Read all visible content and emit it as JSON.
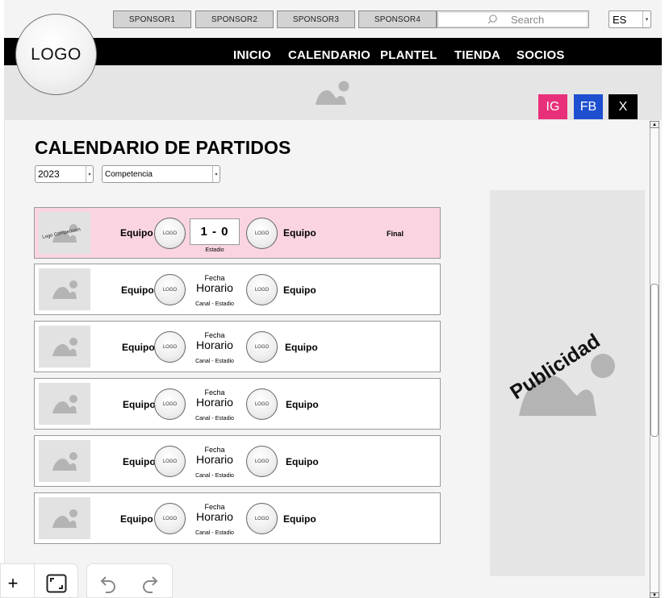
{
  "header": {
    "sponsors": [
      "SPONSOR1",
      "SPONSOR2",
      "SPONSOR3",
      "SPONSOR4"
    ],
    "search": {
      "placeholder": "Search"
    },
    "language": "ES",
    "logo": "LOGO"
  },
  "nav": {
    "items": [
      "INICIO",
      "CALENDARIO",
      "PLANTEL",
      "TIENDA",
      "SOCIOS"
    ]
  },
  "social": {
    "ig": "IG",
    "fb": "FB",
    "x": "X",
    "colors": {
      "ig": "#e8307a",
      "fb": "#1d4fd0",
      "x": "#000000"
    }
  },
  "page": {
    "title": "CALENDARIO DE PARTIDOS",
    "filters": {
      "year": "2023",
      "competition": "Competencia"
    }
  },
  "matches": [
    {
      "home": "Equipo",
      "away": "Equipo",
      "home_logo": "LOGO",
      "away_logo": "LOGO",
      "score": "1 - 0",
      "venue": "Estadio",
      "status": "Final",
      "thumb_label": "Logo Competicion"
    },
    {
      "home": "Equipo",
      "away": "Equipo",
      "home_logo": "LOGO",
      "away_logo": "LOGO",
      "date": "Fecha",
      "time": "Horario",
      "venue": "Canal - Estadio"
    },
    {
      "home": "Equipo",
      "away": "Equipo",
      "home_logo": "LOGO",
      "away_logo": "LOGO",
      "date": "Fecha",
      "time": "Horario",
      "venue": "Canal - Estadio"
    },
    {
      "home": "Equipo",
      "away": "Equipo",
      "home_logo": "LOGO",
      "away_logo": "LOGO",
      "date": "Fecha",
      "time": "Horario",
      "venue": "Canal - Estadio"
    },
    {
      "home": "Equipo",
      "away": "Equipo",
      "home_logo": "LOGO",
      "away_logo": "LOGO",
      "date": "Fecha",
      "time": "Horario",
      "venue": "Canal - Estadio"
    },
    {
      "home": "Equipo",
      "away": "Equipo",
      "home_logo": "LOGO",
      "away_logo": "LOGO",
      "date": "Fecha",
      "time": "Horario",
      "venue": "Canal - Estadio"
    }
  ],
  "ad": {
    "label": "Publicidad"
  },
  "colors": {
    "featured_row": "#fad5e1",
    "navbar": "#000000"
  },
  "toolbar": {
    "icons": [
      "plus-icon",
      "fit-screen-icon",
      "undo-icon",
      "redo-icon"
    ],
    "add": "+"
  }
}
